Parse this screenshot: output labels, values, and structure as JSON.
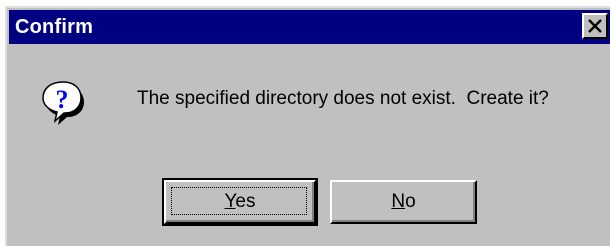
{
  "window": {
    "title": "Confirm",
    "close_icon": "close-x-icon"
  },
  "dialog": {
    "icon": "question-icon",
    "message": "The specified directory does not exist.  Create it?"
  },
  "buttons": {
    "yes": {
      "mnemonic": "Y",
      "rest": "es",
      "default": true
    },
    "no": {
      "mnemonic": "N",
      "rest": "o"
    }
  },
  "colors": {
    "titlebar": "#000080",
    "face": "#c0c0c0",
    "icon_blue": "#0000ff"
  }
}
